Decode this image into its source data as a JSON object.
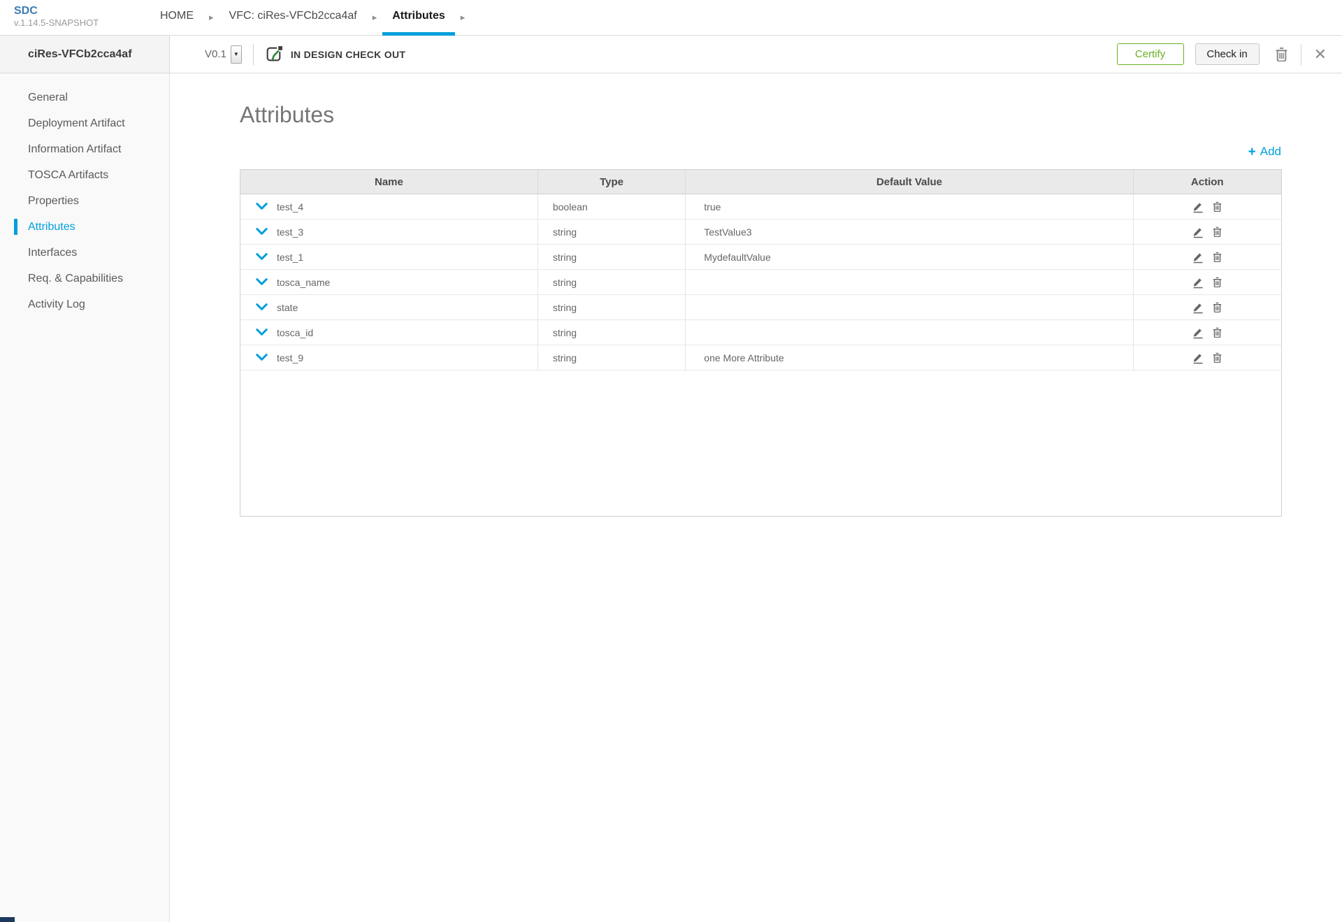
{
  "app": {
    "logo": "SDC",
    "version": "v.1.14.5-SNAPSHOT"
  },
  "breadcrumb": {
    "arrow_icon": "▸",
    "items": [
      {
        "label": "HOME"
      },
      {
        "label": "VFC: ciRes-VFCb2cca4af"
      },
      {
        "label": "Attributes"
      }
    ]
  },
  "header": {
    "entity_name": "ciRes-VFCb2cca4af",
    "version_label": "V0.1",
    "version_caret": "▼",
    "status": "IN DESIGN CHECK OUT",
    "certify_label": "Certify",
    "checkin_label": "Check in",
    "close_icon": "✕"
  },
  "sidebar": {
    "items": [
      {
        "label": "General"
      },
      {
        "label": "Deployment Artifact"
      },
      {
        "label": "Information Artifact"
      },
      {
        "label": "TOSCA Artifacts"
      },
      {
        "label": "Properties"
      },
      {
        "label": "Attributes",
        "active": true
      },
      {
        "label": "Interfaces"
      },
      {
        "label": "Req. & Capabilities"
      },
      {
        "label": "Activity Log"
      }
    ]
  },
  "main": {
    "title": "Attributes",
    "add_plus": "+",
    "add_label": "Add",
    "table": {
      "columns": [
        "Name",
        "Type",
        "Default Value",
        "Action"
      ],
      "rows": [
        {
          "name": "test_4",
          "type": "boolean",
          "default": "true"
        },
        {
          "name": "test_3",
          "type": "string",
          "default": "TestValue3"
        },
        {
          "name": "test_1",
          "type": "string",
          "default": "MydefaultValue"
        },
        {
          "name": "tosca_name",
          "type": "string",
          "default": ""
        },
        {
          "name": "state",
          "type": "string",
          "default": ""
        },
        {
          "name": "tosca_id",
          "type": "string",
          "default": ""
        },
        {
          "name": "test_9",
          "type": "string",
          "default": "one More Attribute"
        }
      ]
    }
  },
  "colors": {
    "accent_blue": "#009fdb",
    "logo_blue": "#3d7bb0",
    "certify_green": "#6ab023",
    "table_header_bg": "#eaeaea"
  }
}
